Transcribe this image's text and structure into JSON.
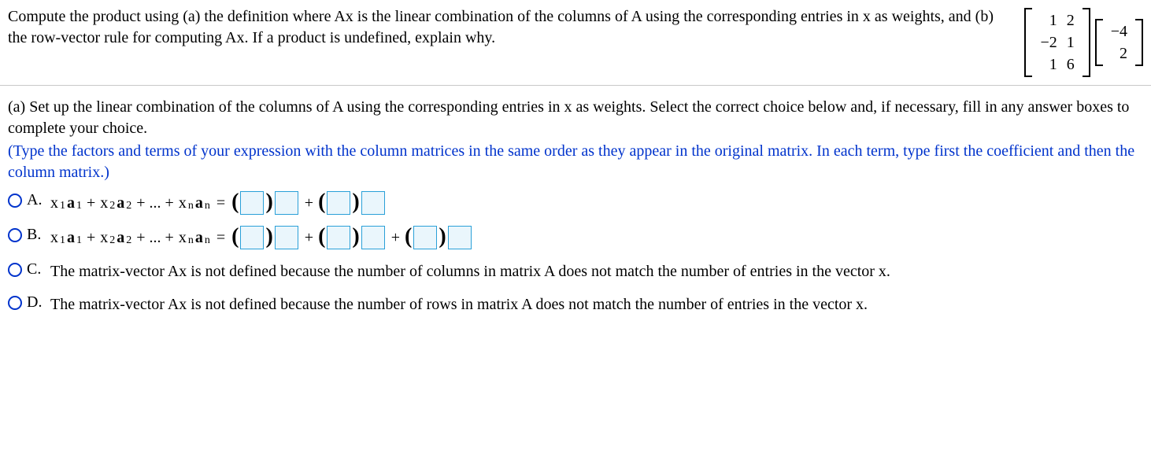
{
  "question": {
    "prompt_line1": "Compute the product using (a) the definition where Ax is the linear combination of the columns of A using",
    "prompt_line2": "the corresponding entries in x as weights, and (b) the row-vector rule for computing Ax. If a product is",
    "prompt_line3": "undefined, explain why.",
    "matrix_A": [
      [
        "1",
        "2"
      ],
      [
        "−2",
        "1"
      ],
      [
        "1",
        "6"
      ]
    ],
    "vector_x": [
      [
        "−4"
      ],
      [
        "2"
      ]
    ]
  },
  "part_a": {
    "intro_line1": "(a) Set up the linear combination of the columns of A using the corresponding entries in x as weights. Select the correct",
    "intro_line2": "choice below and, if necessary, fill in any answer boxes to complete your choice.",
    "hint_line1": "(Type the factors and terms of your expression with the column matrices in the same order as they appear in the",
    "hint_line2": "original matrix. In each term, type first the coefficient and then the column matrix.)"
  },
  "choices": {
    "A": {
      "label": "A."
    },
    "B": {
      "label": "B."
    },
    "C": {
      "label": "C.",
      "text": "The matrix-vector Ax is not defined because the number of columns in matrix A does not match the number of entries in the vector x."
    },
    "D": {
      "label": "D.",
      "text": "The matrix-vector Ax is not defined because the number of rows in matrix A does not match the number of entries in the vector x."
    }
  },
  "math": {
    "lhs_prefix": "x",
    "bold_a": "a",
    "ellipsis": "…",
    "eq": "=",
    "plus": "+",
    "bold_x": "x"
  },
  "chart_data": {
    "type": "table",
    "title": "Matrix-vector product Ax",
    "A": [
      [
        1,
        2
      ],
      [
        -2,
        1
      ],
      [
        1,
        6
      ]
    ],
    "x": [
      -4,
      2
    ],
    "choices": [
      "A",
      "B",
      "C",
      "D"
    ]
  }
}
